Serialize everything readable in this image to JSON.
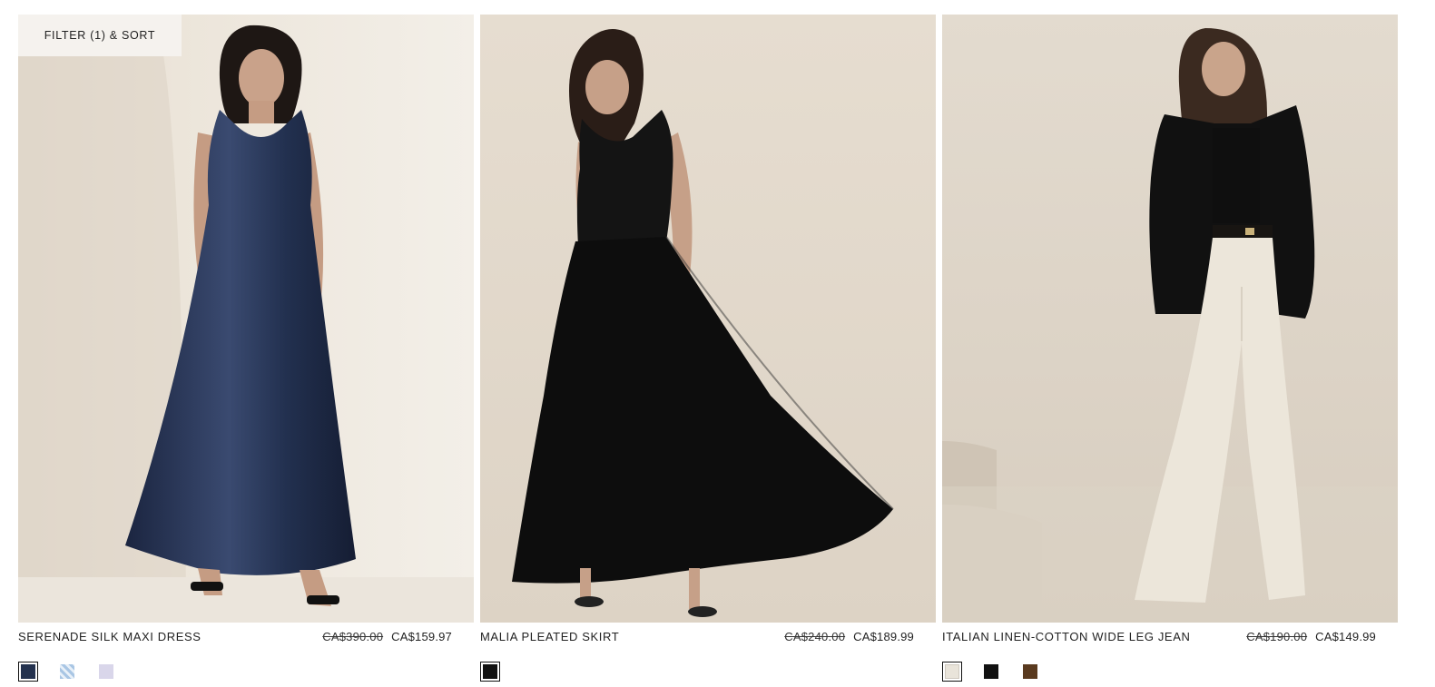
{
  "filter": {
    "label": "FILTER (1) & SORT"
  },
  "products": [
    {
      "name": "SERENADE SILK MAXI DRESS",
      "price_original": "CA$390.00",
      "price_sale": "CA$159.97",
      "swatches": [
        {
          "color": "#24324f",
          "selected": true
        },
        {
          "color": "#b7cfe6",
          "selected": false,
          "pattern": "floral"
        },
        {
          "color": "#d9d6ea",
          "selected": false
        }
      ]
    },
    {
      "name": "MALIA PLEATED SKIRT",
      "price_original": "CA$240.00",
      "price_sale": "CA$189.99",
      "swatches": [
        {
          "color": "#111111",
          "selected": true
        }
      ]
    },
    {
      "name": "ITALIAN LINEN-COTTON WIDE LEG JEAN",
      "price_original": "CA$190.00",
      "price_sale": "CA$149.99",
      "swatches": [
        {
          "color": "#e9e4da",
          "selected": true
        },
        {
          "color": "#111111",
          "selected": false
        },
        {
          "color": "#5a3a1f",
          "selected": false
        }
      ]
    }
  ]
}
